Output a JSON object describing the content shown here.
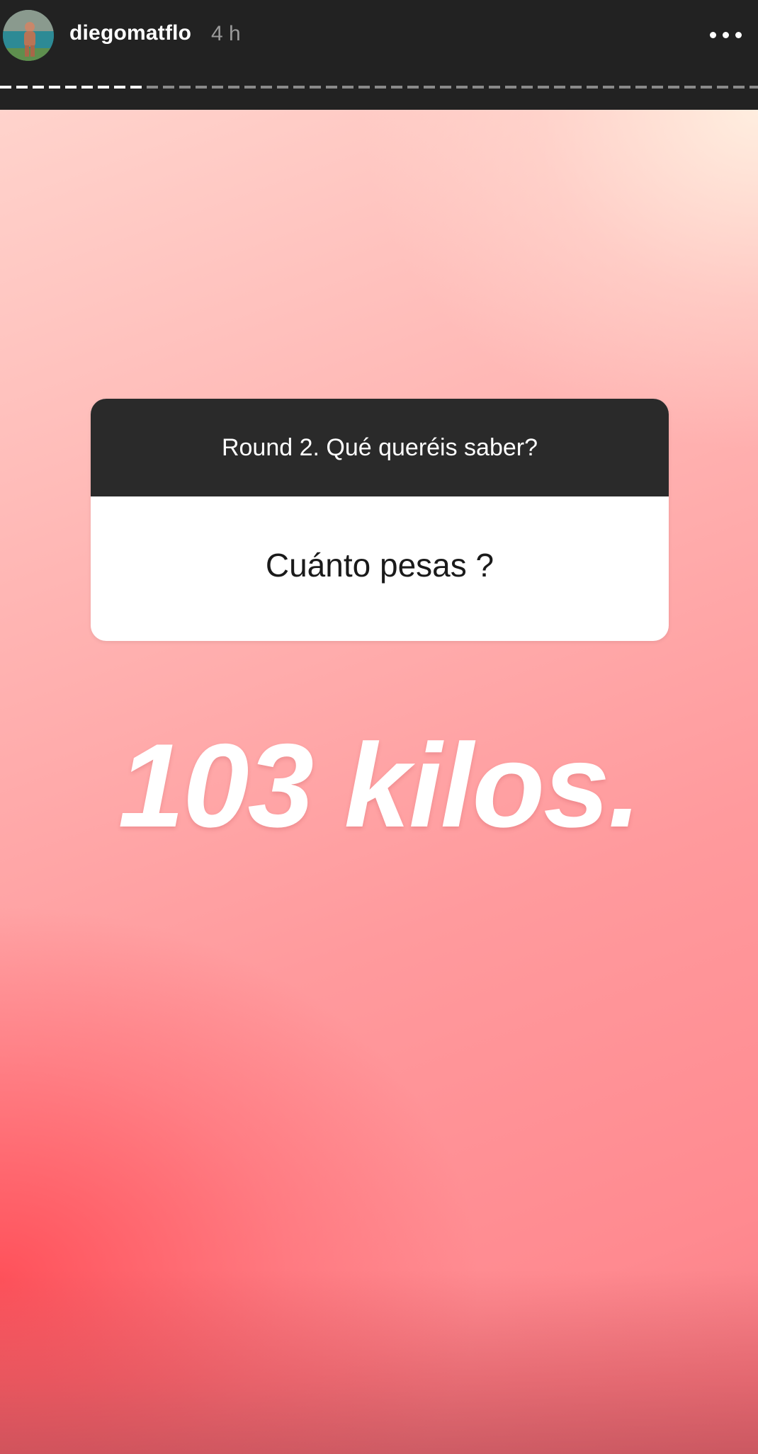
{
  "header": {
    "username": "diegomatflo",
    "timestamp": "4 h",
    "avatar_icon": "profile-photo",
    "more_icon": "more-horizontal-icon",
    "progress": {
      "total_segments": 1,
      "completed_fraction": 0.18,
      "completed_color": "#ffffff",
      "remaining_color": "#8a8a8a"
    }
  },
  "question_sticker": {
    "prompt": "Round 2. Qué queréis saber?",
    "answer": "Cuánto pesas ?"
  },
  "reply_text": "103 kilos.",
  "colors": {
    "header_bg": "#222222",
    "sticker_header_bg": "#2a2a2a",
    "gradient_top_right": "#ffeee0",
    "gradient_bottom_left": "#ff4a55"
  }
}
